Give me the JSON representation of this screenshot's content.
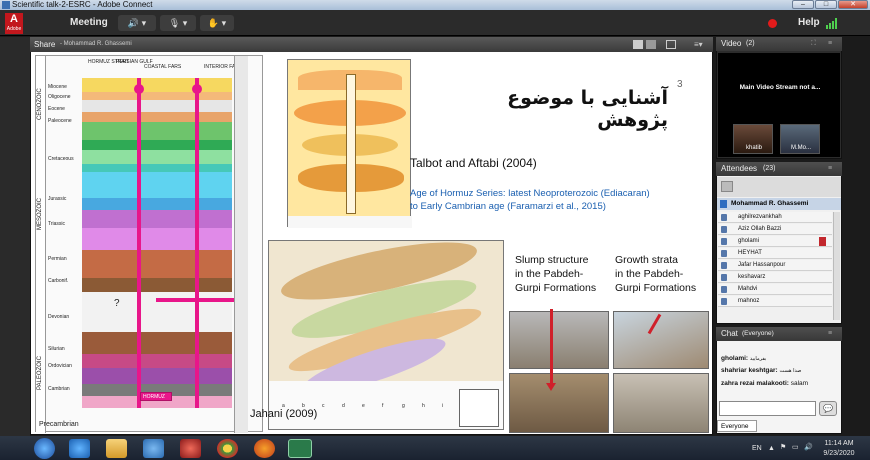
{
  "window": {
    "title": "Scientific talk-2-ESRC - Adobe Connect"
  },
  "menubar": {
    "logo_main": "A",
    "logo_sub": "Adobe",
    "meeting_label": "Meeting",
    "help_label": "Help",
    "dropdown": "▾"
  },
  "share_pod": {
    "title": "Share",
    "presenter": "- Mohammad R. Ghassemi"
  },
  "slide": {
    "page_number": "3",
    "heading": "آشنایی با موضوع پژوهش",
    "ref1": "Talbot and Aftabi (2004)",
    "ref2_line1": "Age of Hormuz Series: latest Neoproterozoic (Ediacaran)",
    "ref2_line2": "to Early Cambrian age (Faramarzi et al., 2015)",
    "slump_line1": "Slump structure",
    "slump_line2": "in the Pabdeh-",
    "slump_line3": "Gurpi Formations",
    "growth_line1": "Growth strata",
    "growth_line2": "in the Pabdeh-",
    "growth_line3": "Gurpi Formations",
    "map_credit": "Jahani (2009)",
    "col_headers": [
      "HORMUZ STRAIT",
      "PERSIAN GULF",
      "COASTAL FARS",
      "INTERIOR FARS"
    ],
    "eras": [
      "CENOZOIC",
      "MESOZOIC",
      "PALEOZOIC"
    ],
    "periods": [
      "Miocene",
      "Oligocene",
      "Eocene",
      "Paleocene",
      "Cretaceous",
      "Jurassic",
      "Triassic",
      "Permian",
      "Carbonif.",
      "Devonian",
      "Silurian",
      "Ordovician",
      "Cambrian",
      "Precambrian"
    ],
    "hormuz_box": "HORMUZ",
    "question_mark": "?",
    "legend_letters": [
      "a",
      "b",
      "c",
      "d",
      "e",
      "f",
      "g",
      "h",
      "i"
    ],
    "accent_colors": {
      "magenta": "#e8168a",
      "red": "#d0202a",
      "blue": "#1a5fb0"
    }
  },
  "video_pod": {
    "title": "Video",
    "count": "(2)",
    "status": "Main Video Stream not a...",
    "tiles": [
      "khatib",
      "M.Mo..."
    ]
  },
  "attendees_pod": {
    "title": "Attendees",
    "count": "(23)",
    "host": "Mohammad R. Ghassemi",
    "list": [
      "aghilrezvankhah",
      "Aziz Ollah Bazzi",
      "gholami",
      "HEYHAT",
      "Jafar Hassanpour",
      "keshavarz",
      "Mahdvi",
      "mahnoz"
    ]
  },
  "chat_pod": {
    "title": "Chat",
    "scope": "(Everyone)",
    "messages": [
      {
        "sender": "gholami:",
        "text": "بفرمایید"
      },
      {
        "sender": "shahriar keshtgar:",
        "text": "صدا هست"
      },
      {
        "sender": "zahra rezai malakooti:",
        "text": "salam"
      }
    ],
    "input_value": "",
    "tab": "Everyone"
  },
  "taskbar": {
    "lang": "EN",
    "time": "11:14 AM",
    "date": "9/23/2020"
  }
}
